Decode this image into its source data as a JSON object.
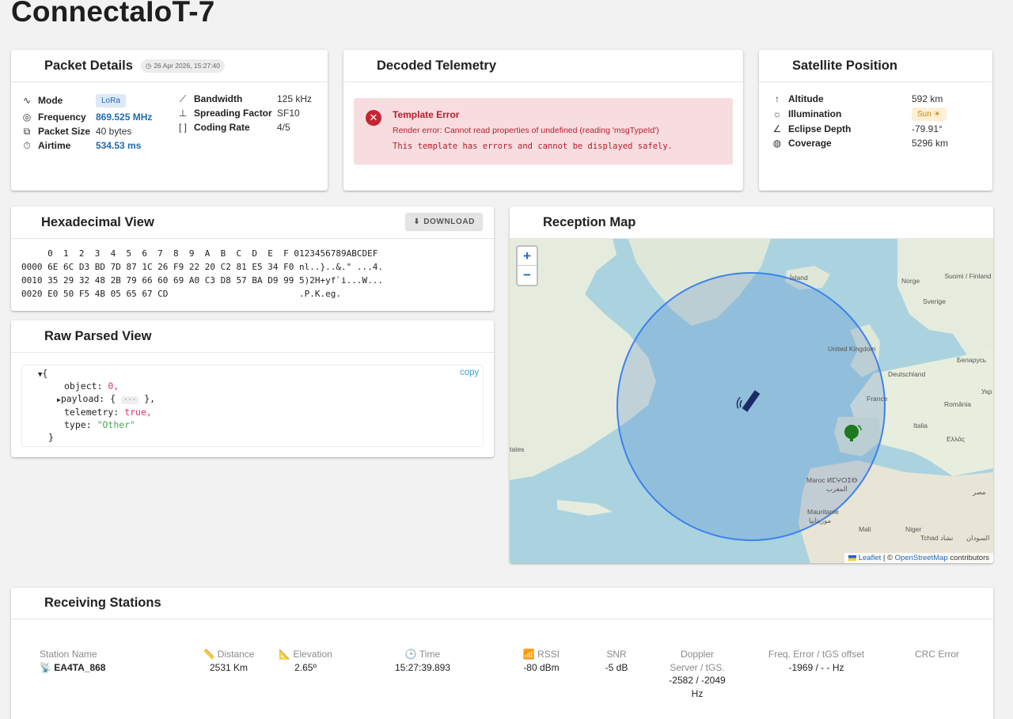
{
  "page": {
    "title": "ConnectaIoT-7"
  },
  "colors": {
    "accent": "#1e6bb8",
    "error": "#c62433",
    "error_bg": "#f7dde0",
    "sun_chip": "#fdf0d6"
  },
  "packet_details": {
    "title": "Packet Details",
    "timestamp": "26 Apr 2026, 15:27:40",
    "left": [
      {
        "icon": "wave-icon",
        "label": "Mode",
        "value": "LoRa"
      },
      {
        "icon": "antenna-icon",
        "label": "Frequency",
        "value": "869.525 MHz"
      },
      {
        "icon": "packet-icon",
        "label": "Packet Size",
        "value": "40 bytes"
      },
      {
        "icon": "timer-icon",
        "label": "Airtime",
        "value": "534.53 ms"
      }
    ],
    "right": [
      {
        "icon": "graph-icon",
        "label": "Bandwidth",
        "value": "125 kHz"
      },
      {
        "icon": "height-icon",
        "label": "Spreading Factor",
        "value": "SF10"
      },
      {
        "icon": "bracket-icon",
        "label": "Coding Rate",
        "value": "4/5"
      }
    ]
  },
  "decoded_telemetry": {
    "title": "Decoded Telemetry",
    "error_title": "Template Error",
    "error_message": "Render error: Cannot read properties of undefined (reading 'msgTypeId')",
    "error_detail": "This template has errors and cannot be displayed safely."
  },
  "satellite_position": {
    "title": "Satellite Position",
    "rows": [
      {
        "icon": "arrow-up-icon",
        "label": "Altitude",
        "value": "592 km"
      },
      {
        "icon": "sun-icon",
        "label": "Illumination",
        "value": "Sun ☀"
      },
      {
        "icon": "angle-icon",
        "label": "Eclipse Depth",
        "value": "-79.91°"
      },
      {
        "icon": "globe-icon",
        "label": "Coverage",
        "value": "5296 km"
      }
    ]
  },
  "hex_view": {
    "title": "Hexadecimal View",
    "download_label": "DOWNLOAD",
    "lines": [
      "     0  1  2  3  4  5  6  7  8  9  A  B  C  D  E  F 0123456789ABCDEF",
      "0000 6E 6C D3 BD 7D 87 1C 26 F9 22 20 C2 81 E5 34 F0 nl..}..&.\" ...4.",
      "0010 35 29 32 48 2B 79 66 60 69 A0 C3 D8 57 BA D9 99 5)2H+yf`i...W...",
      "0020 E0 50 F5 4B 05 65 67 CD                         .P.K.eg."
    ]
  },
  "raw_parsed": {
    "title": "Raw Parsed View",
    "copy_label": "copy",
    "open_brace": "{",
    "close_brace": "}",
    "object_key": "object:",
    "object_val": "0,",
    "payload_key": "payload:",
    "payload_open": "{",
    "payload_collapsed": "···",
    "payload_close": "},",
    "telemetry_key": "telemetry:",
    "telemetry_val": "true,",
    "type_key": "type:",
    "type_val": "\"Other\""
  },
  "reception_map": {
    "title": "Reception Map",
    "zoom_in": "+",
    "zoom_out": "−",
    "attribution_leaflet": "Leaflet",
    "attribution_sep": " | © ",
    "attribution_osm": "OpenStreetMap",
    "attribution_tail": " contributors",
    "labels": [
      "Ísland",
      "Norge",
      "Suomi / Finland",
      "Sverige",
      "United Kingdom",
      "Беларусь",
      "Deutschland",
      "France",
      "Укр",
      "România",
      "Italia",
      "Ελλάς",
      "tates",
      "Maroc ⵍⵎⵖⵔⵉⴱ",
      "المغرب",
      "مصر",
      "Mauritanie",
      "موريتانيا",
      "Mali",
      "Niger",
      "Tchad تشاد",
      "السودان"
    ]
  },
  "stations": {
    "title": "Receiving Stations",
    "headers": {
      "name": "Station Name",
      "distance": "📏 Distance",
      "elevation": "📐 Elevation",
      "time": "🕒 Time",
      "rssi": "📶 RSSI",
      "snr": "SNR",
      "doppler_1": "Doppler",
      "doppler_2": "Server / tGS.",
      "freq_error": "Freq. Error / tGS offset",
      "crc": "CRC Error"
    },
    "row": {
      "name": "EA4TA_868",
      "distance": "2531 Km",
      "elevation": "2.65º",
      "time": "15:27:39.893",
      "rssi": "-80 dBm",
      "snr": "-5 dB",
      "doppler_1": "-2582 / -2049",
      "doppler_2": "Hz",
      "freq_error": "-1969 / - - Hz"
    }
  }
}
